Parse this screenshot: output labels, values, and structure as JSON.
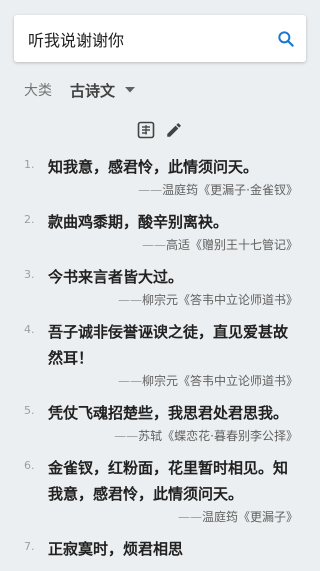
{
  "search": {
    "value": "听我说谢谢你",
    "placeholder": ""
  },
  "filter": {
    "label": "大类",
    "selected": "古诗文"
  },
  "results": [
    {
      "num": "1.",
      "text": "知我意，感君怜，此情须问天。",
      "dash": "——",
      "source": "温庭筠《更漏子·金雀钗》"
    },
    {
      "num": "2.",
      "text": "款曲鸡黍期，酸辛别离袂。",
      "dash": "——",
      "source": "高适《赠别王十七管记》"
    },
    {
      "num": "3.",
      "text": "今书来言者皆大过。",
      "dash": "——",
      "source": "柳宗元《答韦中立论师道书》"
    },
    {
      "num": "4.",
      "text": "吾子诚非佞誉诬谀之徒，直见爱甚故然耳！",
      "dash": "——",
      "source": "柳宗元《答韦中立论师道书》"
    },
    {
      "num": "5.",
      "text": "凭仗飞魂招楚些，我思君处君思我。",
      "dash": "——",
      "source": "苏轼《蝶恋花·暮春别李公择》"
    },
    {
      "num": "6.",
      "text": "金雀钗，红粉面，花里暂时相见。知我意，感君怜，此情须问天。",
      "dash": "——",
      "source": "温庭筠《更漏子》"
    },
    {
      "num": "7.",
      "text": "正寂寞时，烦君相思",
      "dash": "",
      "source": ""
    }
  ],
  "icons": {
    "search": "search-icon",
    "dropdown": "caret-down-icon",
    "translate": "translate-icon",
    "edit": "pencil-icon"
  },
  "colors": {
    "accent": "#1976d2",
    "background": "#eceff1"
  }
}
